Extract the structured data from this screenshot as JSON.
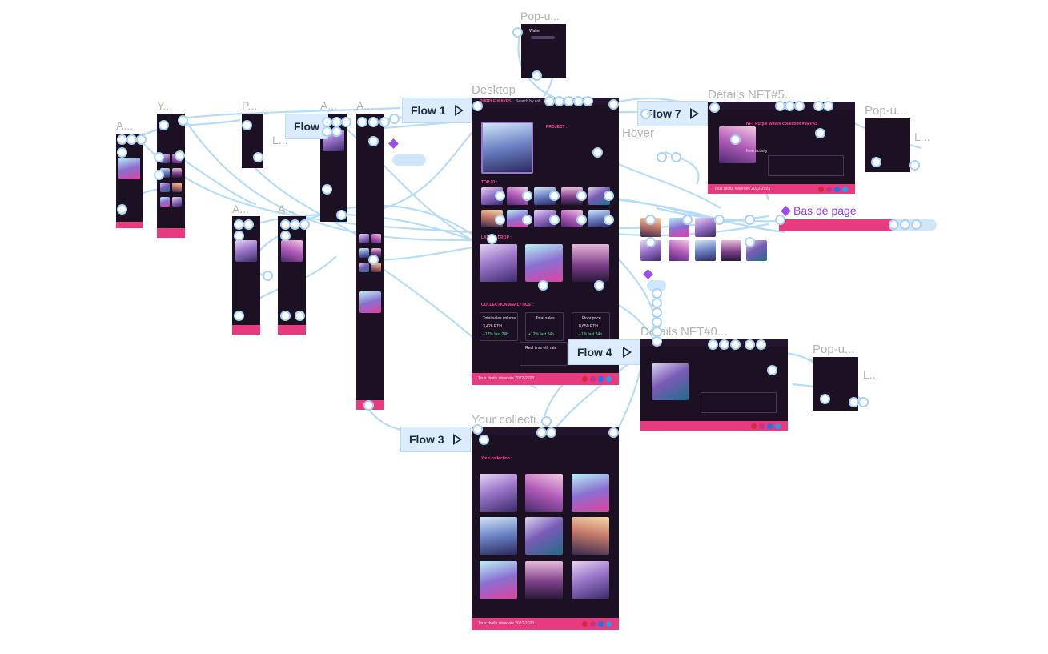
{
  "frames": {
    "desktop": {
      "label": "Desktop"
    },
    "your_collection": {
      "label": "Your collecti..."
    },
    "details_top": {
      "label": "Détails NFT#5..."
    },
    "details_bottom": {
      "label": "Détails NFT#0..."
    },
    "popup_top": {
      "label": "Pop-u..."
    },
    "popup_right_top": {
      "label": "Pop-u..."
    },
    "popup_right_bottom": {
      "label": "Pop-u..."
    },
    "l_right_top": {
      "label": "L..."
    },
    "l_right_bottom": {
      "label": "L..."
    },
    "l_mid": {
      "label": "L..."
    },
    "hover": {
      "label": "Hover"
    },
    "mobile_a1": {
      "label": "A..."
    },
    "mobile_y": {
      "label": "Y..."
    },
    "mobile_p": {
      "label": "P..."
    },
    "mobile_a2": {
      "label": "A..."
    },
    "mobile_a3": {
      "label": "A..."
    },
    "mobile_a4": {
      "label": "A..."
    },
    "mobile_a5": {
      "label": "A..."
    }
  },
  "flows": [
    {
      "label": "Flow 1"
    },
    {
      "label": "Flow"
    },
    {
      "label": "Flow 7"
    },
    {
      "label": "Flow 4"
    },
    {
      "label": "Flow 3"
    }
  ],
  "component": {
    "bas_de_page": "Bas de page"
  },
  "desktop_content": {
    "brand": "PURPLE WAVES",
    "search": "Search by coll...",
    "project_title": "PROJECT :",
    "top_title": "TOP 10 :",
    "latest_title": "LATEST DROP :",
    "collection_title": "COLLECTION ANALYTICS :",
    "stat1_title": "Total sales volume",
    "stat1_value": "3,426 ETH",
    "stat1_delta": "+17% last 24h",
    "stat2_title": "Total sales",
    "stat2_delta": "+12% last 24h",
    "stat3_title": "Floor price",
    "stat3_value": "0,650 ETH",
    "stat3_delta": "+1% last 24h",
    "realtime": "Real time eth rate",
    "footer": "Tous droits réservés 2022-2023"
  },
  "collection_content": {
    "title": "Your collection :",
    "footer": "Tous droits réservés 2022-2023"
  },
  "details_content": {
    "title": "NFT Purple Waves collection #56 PAS",
    "activity": "Item activity",
    "footer": "Tous droits réservés 2022-2023"
  },
  "colors": {
    "frame_bg": "#1c1023",
    "footer_pink": "#e83a7f",
    "wire_blue": "#b6dcf8",
    "flow_bg": "#dcecfc",
    "component_purple": "#8a3ff0"
  }
}
